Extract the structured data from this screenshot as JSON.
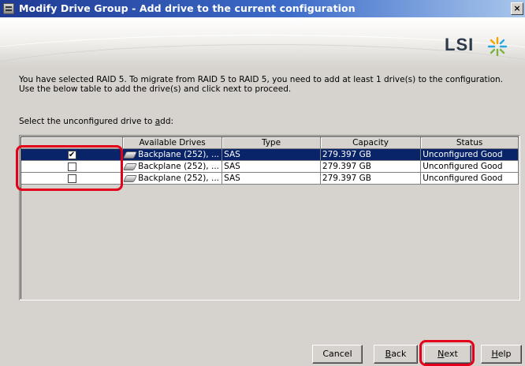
{
  "window": {
    "title": "Modify Drive Group - Add drive to the current configuration",
    "close_glyph": "×"
  },
  "banner": {
    "logo_text": "LSI"
  },
  "intro": {
    "line1": "You have selected RAID 5. To migrate from RAID 5 to RAID 5, you need to add at least 1 drive(s) to the configuration.",
    "line2": "Use the below table to add the drive(s) and click next to proceed."
  },
  "select_label": "Select the unconfigured drive to add:",
  "table": {
    "columns": [
      "",
      "Available Drives",
      "Type",
      "Capacity",
      "Status"
    ],
    "rows": [
      {
        "checked": "✔",
        "drive": "Backplane (252), ...",
        "type": "SAS",
        "capacity": "279.397 GB",
        "status": "Unconfigured Good"
      },
      {
        "checked": "",
        "drive": "Backplane (252), ...",
        "type": "SAS",
        "capacity": "279.397 GB",
        "status": "Unconfigured Good"
      },
      {
        "checked": "",
        "drive": "Backplane (252), ...",
        "type": "SAS",
        "capacity": "279.397 GB",
        "status": "Unconfigured Good"
      }
    ]
  },
  "buttons": {
    "cancel": "Cancel",
    "back": "Back",
    "next": "Next",
    "help": "Help"
  },
  "colors": {
    "title_bar": "#1f3a93",
    "selection": "#0a246a",
    "highlight": "#e2001a",
    "dialog_bg": "#d6d3ce"
  }
}
